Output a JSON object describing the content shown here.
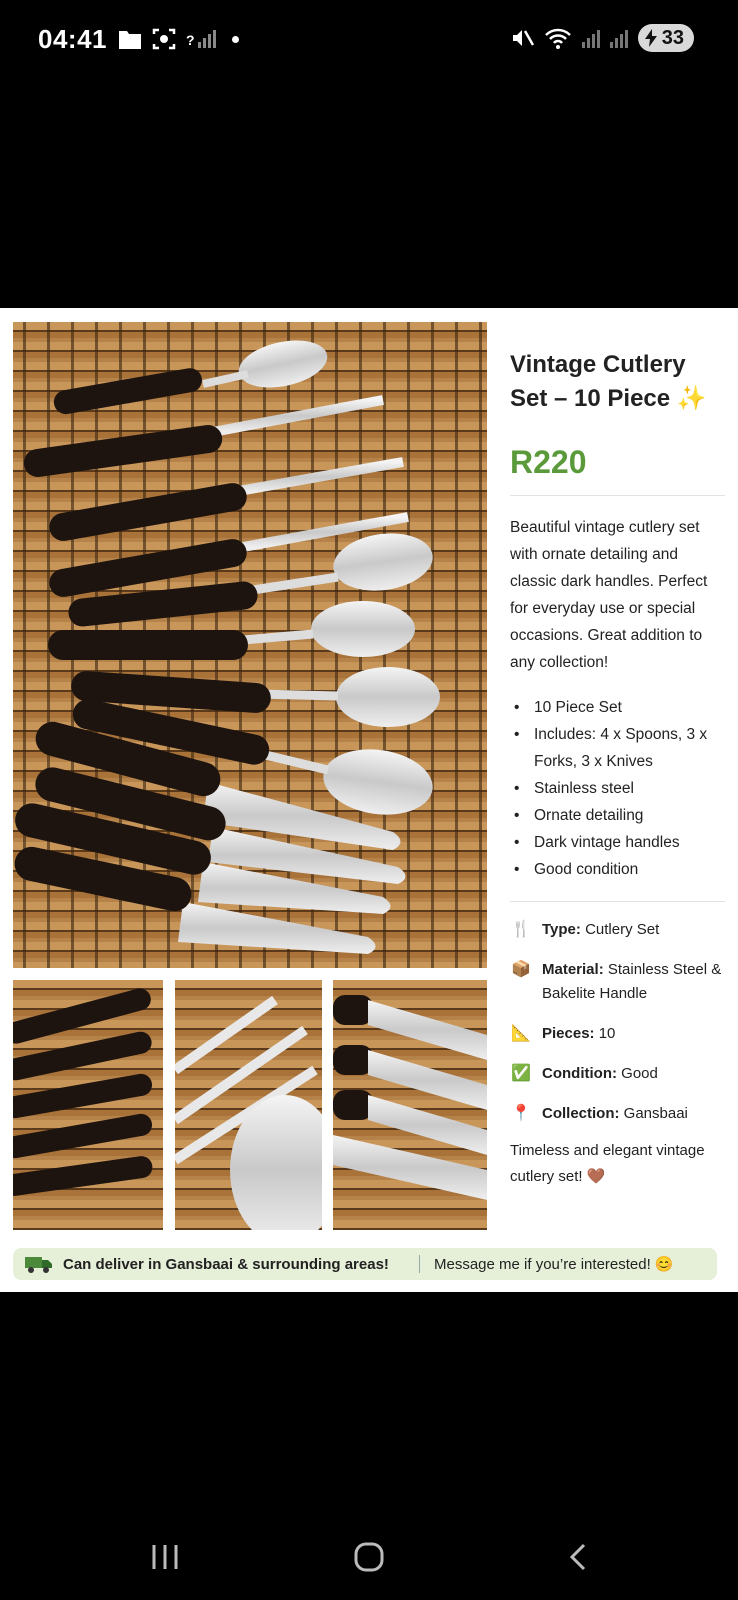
{
  "status": {
    "time": "04:41",
    "battery": "33",
    "signal_q": "?"
  },
  "listing": {
    "title": "Vintage Cutlery Set – 10 Piece ✨",
    "price": "R220",
    "description": "Beautiful vintage cutlery set with ornate detailing and classic dark handles. Perfect for everyday use or special occasions. Great addition to any collection!",
    "features": [
      "10 Piece Set",
      "Includes: 4 x Spoons, 3 x Forks, 3 x Knives",
      "Stainless steel",
      "Ornate detailing",
      "Dark vintage handles",
      "Good condition"
    ],
    "specs": [
      {
        "icon": "🍴",
        "icon_name": "cutlery-icon",
        "label": "Type:",
        "value": "Cutlery Set"
      },
      {
        "icon": "📦",
        "icon_name": "package-icon",
        "label": "Material:",
        "value": "Stainless Steel & Bakelite Handle"
      },
      {
        "icon": "📐",
        "icon_name": "triangle-ruler-icon",
        "label": "Pieces:",
        "value": "10"
      },
      {
        "icon": "✅",
        "icon_name": "check-icon",
        "label": "Condition:",
        "value": "Good"
      },
      {
        "icon": "📍",
        "icon_name": "pin-icon",
        "label": "Collection:",
        "value": "Gansbaai"
      }
    ],
    "closing": "Timeless and elegant vintage cutlery set! 🤎",
    "banner": {
      "delivery": "Can deliver in Gansbaai & surrounding areas!",
      "message": "Message me if you’re interested! 😊"
    },
    "accent_color": "#5a9a3a"
  }
}
